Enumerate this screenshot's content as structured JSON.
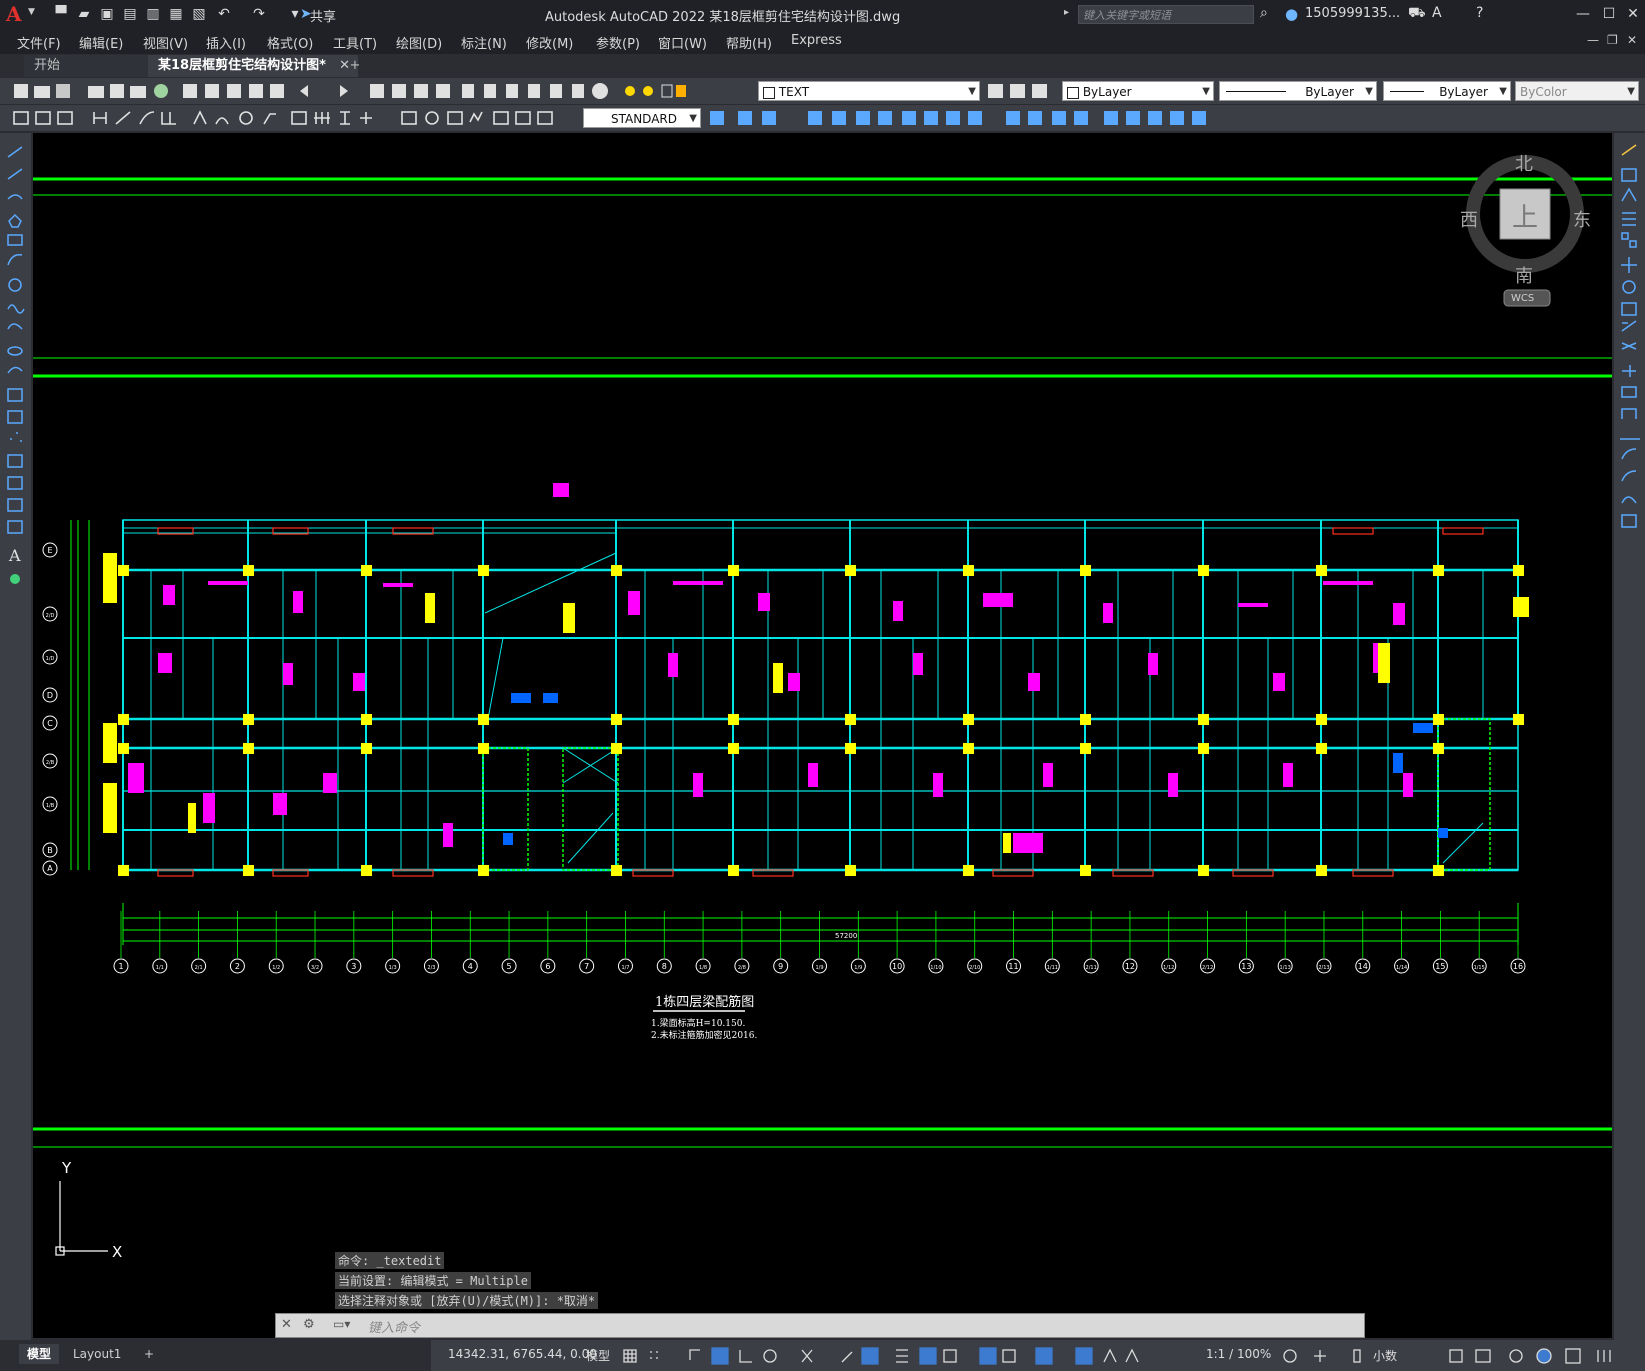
{
  "app": {
    "logo": "A",
    "title": "Autodesk AutoCAD 2022    某18层框剪住宅结构设计图.dwg",
    "share": "共享",
    "search_placeholder": "键入关键字或短语",
    "user": "1505999135...",
    "window_buttons": [
      "—",
      "☐",
      "✕"
    ]
  },
  "menu": [
    "文件(F)",
    "编辑(E)",
    "视图(V)",
    "插入(I)",
    "格式(O)",
    "工具(T)",
    "绘图(D)",
    "标注(N)",
    "修改(M)",
    "参数(P)",
    "窗口(W)",
    "帮助(H)",
    "Express"
  ],
  "tabs": {
    "start": "开始",
    "file": "某18层框剪住宅结构设计图*",
    "close": "✕",
    "add": "+"
  },
  "properties": {
    "layer": "TEXT",
    "color": "ByLayer",
    "linetype": "ByLayer",
    "lineweight": "ByLayer",
    "plotstyle": "ByColor",
    "textstyle": "STANDARD"
  },
  "viewcube": {
    "north": "北",
    "south": "南",
    "east": "东",
    "west": "西",
    "top": "上",
    "wcs": "WCS"
  },
  "drawing": {
    "plan_title": "1栋四层梁配筋图",
    "note_1": "1.梁面标高H=10.150.",
    "note_2": "2.未标注箍筋加密见2016.",
    "total_dim": "57200",
    "axis_labels_bottom": [
      "1",
      "1/1",
      "2/1",
      "2",
      "1/2",
      "3/2",
      "3",
      "1/3",
      "2/3",
      "4",
      "5",
      "6",
      "7",
      "1/7",
      "8",
      "1/8",
      "2/8",
      "9",
      "1/9",
      "1/9",
      "10",
      "1/10",
      "2/10",
      "11",
      "1/11",
      "2/11",
      "12",
      "1/12",
      "2/12",
      "13",
      "1/13",
      "2/13",
      "14",
      "1/14",
      "15",
      "1/15",
      "16"
    ],
    "axis_labels_left": [
      "E",
      "2/D",
      "1/D",
      "D",
      "C",
      "2/B",
      "1/B",
      "B",
      "A"
    ]
  },
  "ucs": {
    "x": "X",
    "y": "Y"
  },
  "command": {
    "history": [
      "命令: _textedit",
      "当前设置: 编辑模式 = Multiple",
      "选择注释对象或 [放弃(U)/模式(M)]: *取消*"
    ],
    "placeholder": "键入命令"
  },
  "status": {
    "tab_model": "模型",
    "tab_layout": "Layout1",
    "tab_add": "+",
    "coords": "14342.31, 6765.44, 0.00",
    "space": "模型",
    "scale": "1:1 / 100%",
    "units": "小数"
  }
}
